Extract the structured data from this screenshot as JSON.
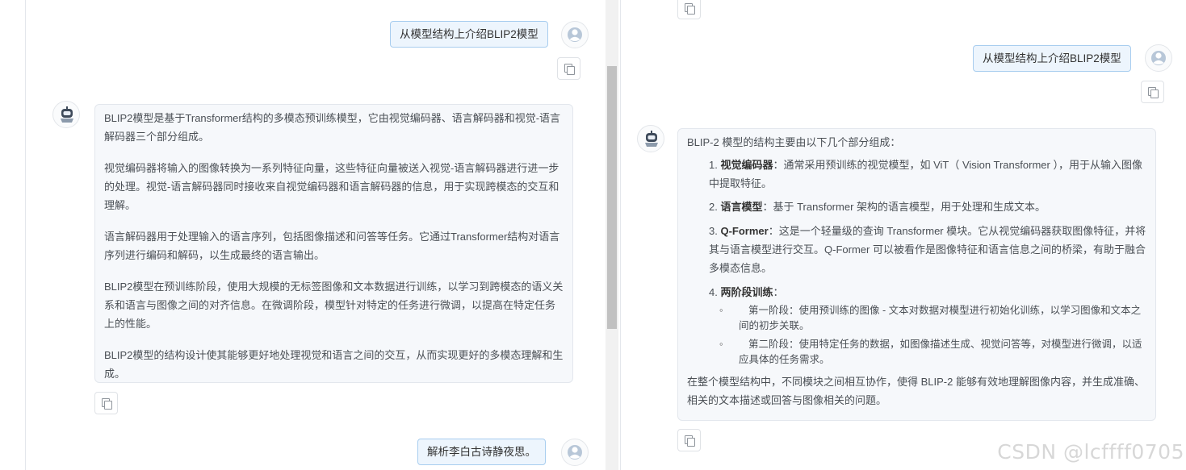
{
  "left": {
    "user_question_1": "从模型结构上介绍BLIP2模型",
    "ai_answer_paragraphs": [
      "BLIP2模型是基于Transformer结构的多模态预训练模型，它由视觉编码器、语言解码器和视觉-语言解码器三个部分组成。",
      "视觉编码器将输入的图像转换为一系列特征向量，这些特征向量被送入视觉-语言解码器进行进一步的处理。视觉-语言解码器同时接收来自视觉编码器和语言解码器的信息，用于实现跨模态的交互和理解。",
      "语言解码器用于处理输入的语言序列，包括图像描述和问答等任务。它通过Transformer结构对语言序列进行编码和解码，以生成最终的语言输出。",
      "BLIP2模型在预训练阶段，使用大规模的无标签图像和文本数据进行训练，以学习到跨模态的语义关系和语言与图像之间的对齐信息。在微调阶段，模型针对特定的任务进行微调，以提高在特定任务上的性能。",
      "BLIP2模型的结构设计使其能够更好地处理视觉和语言之间的交互，从而实现更好的多模态理解和生成。"
    ],
    "user_question_2": "解析李白古诗静夜思。"
  },
  "right": {
    "user_question": "从模型结构上介绍BLIP2模型",
    "intro": "BLIP-2 模型的结构主要由以下几个部分组成：",
    "items": [
      {
        "num": "1. ",
        "title": "视觉编码器",
        "text": "：通常采用预训练的视觉模型，如 ViT（ Vision Transformer ），用于从输入图像中提取特征。"
      },
      {
        "num": "2. ",
        "title": "语言模型",
        "text": "：基于 Transformer 架构的语言模型，用于处理和生成文本。"
      },
      {
        "num": "3. ",
        "title": "Q-Former",
        "text": "：这是一个轻量级的查询 Transformer 模块。它从视觉编码器获取图像特征，并将其与语言模型进行交互。Q-Former 可以被看作是图像特征和语言信息之间的桥梁，有助于融合多模态信息。"
      },
      {
        "num": "4. ",
        "title": "两阶段训练",
        "text": "：",
        "subitems": [
          "第一阶段：使用预训练的图像 - 文本对数据对模型进行初始化训练，以学习图像和文本之间的初步关联。",
          "第二阶段：使用特定任务的数据，如图像描述生成、视觉问答等，对模型进行微调，以适应具体的任务需求。"
        ]
      }
    ],
    "outro": "在整个模型结构中，不同模块之间相互协作，使得 BLIP-2 能够有效地理解图像内容，并生成准确、相关的文本描述或回答与图像相关的问题。"
  },
  "watermark": "CSDN @lcffff0705",
  "icons": {
    "copy": "copy-icon",
    "user_avatar": "user-avatar-icon",
    "bot_avatar": "robot-avatar-icon"
  }
}
